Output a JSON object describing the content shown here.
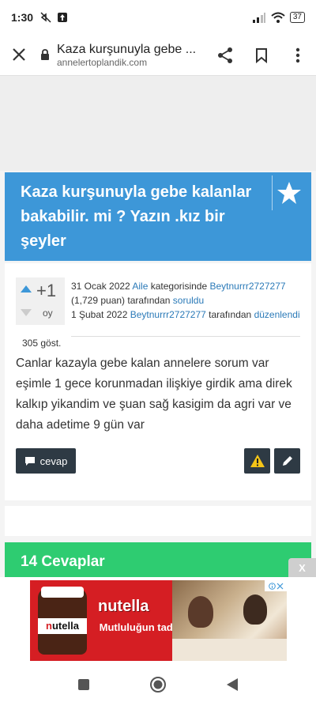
{
  "status_bar": {
    "time": "1:30",
    "battery": "37"
  },
  "browser": {
    "page_title": "Kaza kurşunuyla gebe ...",
    "url": "annelertoplandik.com"
  },
  "question": {
    "title": "Kaza kurşunuyla gebe kalanlar bakabilir. mi ? Yazın .kız bir şeyler",
    "votes": "+1",
    "votes_label": "oy",
    "meta": {
      "date_asked": "31 Ocak 2022",
      "category": "Aile",
      "category_suffix": "kategorisinde",
      "asker": "Beytnurrr2727277",
      "points": "(1,729 puan)",
      "by_text": "tarafından",
      "asked_action": "soruldu",
      "date_edited": "1 Şubat 2022",
      "editor": "Beytnurrr2727277",
      "edited_action": "düzenlendi"
    },
    "views": "305 göst.",
    "body": "Canlar kazayla gebe kalan annelere sorum var eşimle 1 gece korunmadan ilişkiye girdik ama direk kalkıp yikandim ve şuan sağ kasigim da agri var ve daha adetime 9 gün var",
    "answer_button": "cevap"
  },
  "answers": {
    "title": "14 Cevaplar"
  },
  "ad": {
    "close_label": "X",
    "brand": "nutella",
    "slogan": "Mutluluğun tadı",
    "jar_label_n": "n",
    "jar_label_rest": "utella"
  },
  "colors": {
    "header_blue": "#3d97d8",
    "answers_green": "#2ecc71",
    "button_dark": "#2e3a44",
    "link_blue": "#2b7ab8",
    "warning_yellow": "#f5c518"
  },
  "icons": {
    "close": "close-icon",
    "lock": "lock-icon",
    "share": "share-icon",
    "bookmark": "bookmark-icon",
    "more": "more-vert-icon",
    "favorite": "star-icon",
    "answer": "chat-bubble-icon",
    "flag": "warning-icon",
    "edit": "pencil-icon"
  }
}
